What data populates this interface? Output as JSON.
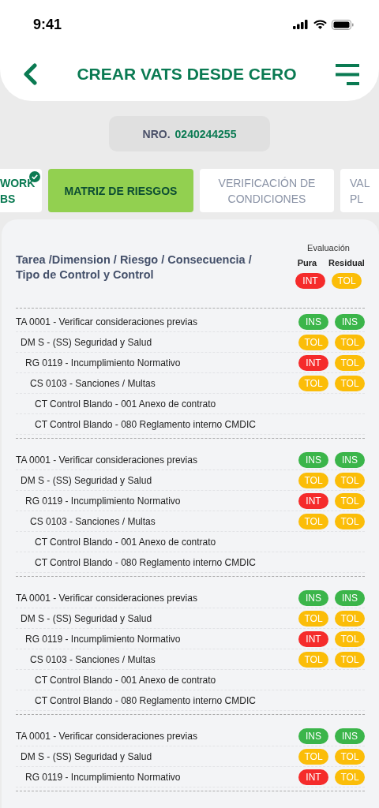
{
  "status_bar": {
    "time": "9:41"
  },
  "header": {
    "title": "CREAR VATS DESDE CERO"
  },
  "number": {
    "label": "NRO.",
    "value": "0240244255"
  },
  "tabs": [
    {
      "lines": [
        "WORK",
        "BS"
      ],
      "selected": false,
      "completed": true
    },
    {
      "lines": [
        "MATRIZ DE RIESGOS"
      ],
      "selected": true,
      "completed": false
    },
    {
      "lines": [
        "VERIFICACIÓN DE",
        "CONDICIONES"
      ],
      "selected": false,
      "completed": false
    },
    {
      "lines": [
        "VAL",
        "PL"
      ],
      "selected": false,
      "completed": false
    }
  ],
  "matrix": {
    "heading": "Tarea /Dimension / Riesgo / Consecuencia / Tipo de Control y Control",
    "evaluation_label": "Evaluación",
    "pura_label": "Pura",
    "residual_label": "Residual",
    "pura": {
      "label": "INT",
      "color": "#f52b2b"
    },
    "residual": {
      "label": "TOL",
      "color": "#fbbd08"
    },
    "tasks": [
      {
        "text": "TA 0001 - Verificar consideraciones previas",
        "pura": {
          "label": "INS",
          "color": "#3bb54a"
        },
        "residual": {
          "label": "INS",
          "color": "#3bb54a"
        },
        "children": [
          {
            "text": "DM S - (SS) Seguridad y Salud",
            "pura": {
              "label": "TOL",
              "color": "#fbbd08"
            },
            "residual": {
              "label": "TOL",
              "color": "#fbbd08"
            },
            "children": [
              {
                "text": "RG 0119 - Incumplimiento Normativo",
                "pura": {
                  "label": "INT",
                  "color": "#f52b2b"
                },
                "residual": {
                  "label": "TOL",
                  "color": "#fbbd08"
                },
                "children": [
                  {
                    "text": "CS 0103 - Sanciones / Multas",
                    "pura": {
                      "label": "TOL",
                      "color": "#fbbd08"
                    },
                    "residual": {
                      "label": "TOL",
                      "color": "#fbbd08"
                    },
                    "children": [
                      {
                        "text": "CT Control Blando - 001 Anexo de contrato"
                      },
                      {
                        "text": "CT Control Blando - 080 Reglamento interno CMDIC"
                      }
                    ]
                  }
                ]
              }
            ]
          }
        ]
      },
      {
        "text": "TA 0001 - Verificar consideraciones previas",
        "pura": {
          "label": "INS",
          "color": "#3bb54a"
        },
        "residual": {
          "label": "INS",
          "color": "#3bb54a"
        },
        "children": [
          {
            "text": "DM S - (SS) Seguridad y Salud",
            "pura": {
              "label": "TOL",
              "color": "#fbbd08"
            },
            "residual": {
              "label": "TOL",
              "color": "#fbbd08"
            },
            "children": [
              {
                "text": "RG 0119 - Incumplimiento Normativo",
                "pura": {
                  "label": "INT",
                  "color": "#f52b2b"
                },
                "residual": {
                  "label": "TOL",
                  "color": "#fbbd08"
                },
                "children": [
                  {
                    "text": "CS 0103 - Sanciones / Multas",
                    "pura": {
                      "label": "TOL",
                      "color": "#fbbd08"
                    },
                    "residual": {
                      "label": "TOL",
                      "color": "#fbbd08"
                    },
                    "children": [
                      {
                        "text": "CT Control Blando - 001 Anexo de contrato"
                      },
                      {
                        "text": "CT Control Blando - 080 Reglamento interno CMDIC"
                      }
                    ]
                  }
                ]
              }
            ]
          }
        ]
      },
      {
        "text": "TA 0001 - Verificar consideraciones previas",
        "pura": {
          "label": "INS",
          "color": "#3bb54a"
        },
        "residual": {
          "label": "INS",
          "color": "#3bb54a"
        },
        "children": [
          {
            "text": "DM S - (SS) Seguridad y Salud",
            "pura": {
              "label": "TOL",
              "color": "#fbbd08"
            },
            "residual": {
              "label": "TOL",
              "color": "#fbbd08"
            },
            "children": [
              {
                "text": "RG 0119 - Incumplimiento Normativo",
                "pura": {
                  "label": "INT",
                  "color": "#f52b2b"
                },
                "residual": {
                  "label": "TOL",
                  "color": "#fbbd08"
                },
                "children": [
                  {
                    "text": "CS 0103 - Sanciones / Multas",
                    "pura": {
                      "label": "TOL",
                      "color": "#fbbd08"
                    },
                    "residual": {
                      "label": "TOL",
                      "color": "#fbbd08"
                    },
                    "children": [
                      {
                        "text": "CT Control Blando - 001 Anexo de contrato"
                      },
                      {
                        "text": "CT Control Blando - 080 Reglamento interno CMDIC"
                      }
                    ]
                  }
                ]
              }
            ]
          }
        ]
      },
      {
        "text": "TA 0001 - Verificar consideraciones previas",
        "pura": {
          "label": "INS",
          "color": "#3bb54a"
        },
        "residual": {
          "label": "INS",
          "color": "#3bb54a"
        },
        "children": [
          {
            "text": "DM S - (SS) Seguridad y Salud",
            "pura": {
              "label": "TOL",
              "color": "#fbbd08"
            },
            "residual": {
              "label": "TOL",
              "color": "#fbbd08"
            },
            "children": [
              {
                "text": "RG 0119 - Incumplimiento Normativo",
                "pura": {
                  "label": "INT",
                  "color": "#f52b2b"
                },
                "residual": {
                  "label": "TOL",
                  "color": "#fbbd08"
                }
              }
            ]
          }
        ]
      }
    ]
  }
}
